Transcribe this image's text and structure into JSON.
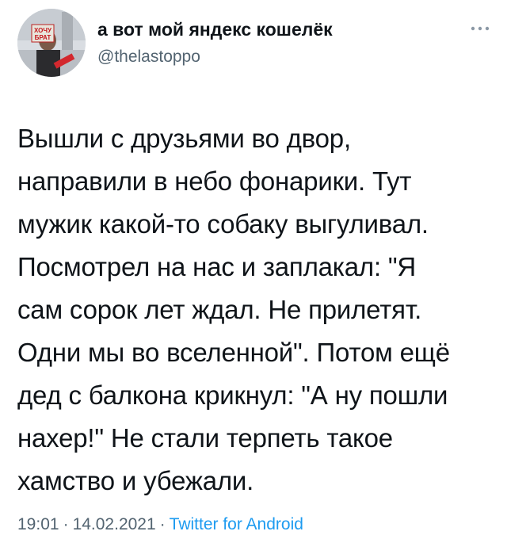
{
  "author": {
    "display_name": "а вот мой яндекс кошелёк",
    "handle": "@thelastoppo",
    "avatar_sign_text": "ХОЧУ БРАТ"
  },
  "header": {
    "more_icon": "more-horizontal-icon"
  },
  "tweet": {
    "lines": [
      "Вышли с друзьями во двор,",
      "направили в небо фонарики. Тут",
      "мужик какой-то собаку выгуливал.",
      "Посмотрел на нас и заплакал: \"Я",
      "сам сорок лет ждал. Не прилетят.",
      "Одни мы во вселенной\". Потом ещё",
      "дед с балкона крикнул: \"А ну пошли",
      "нахер!\" Не стали терпеть такое",
      "хамство и убежали."
    ]
  },
  "meta": {
    "time": "19:01",
    "separator": "·",
    "date": "14.02.2021",
    "source": "Twitter for Android"
  },
  "colors": {
    "text": "#0f1419",
    "secondary": "#536471",
    "link": "#1d9bf0"
  }
}
